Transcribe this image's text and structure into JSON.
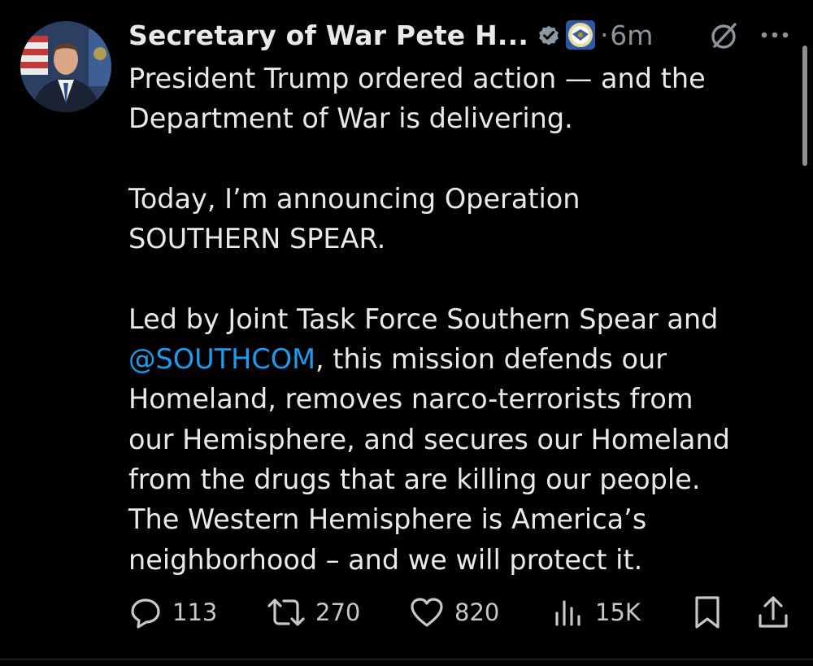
{
  "post": {
    "display_name": "Secretary of War Pete H...",
    "verified_icon": "verified-badge-icon",
    "affiliate_icon": "department-seal-icon",
    "separator": "·",
    "timestamp": "6m",
    "grok_icon": "grok-icon",
    "more_icon": "more-icon",
    "body": {
      "p1_l1": "President Trump ordered action — and the",
      "p1_l2": "Department of War is delivering.",
      "p2_l1": "Today, I’m announcing Operation",
      "p2_l2": "SOUTHERN SPEAR.",
      "p3_l1": "Led by Joint Task Force Southern Spear and",
      "p3_mention": "@SOUTHCOM",
      "p3_l2_rest": ", this mission defends our",
      "p3_l3": "Homeland, removes narco-terrorists from",
      "p3_l4": "our Hemisphere, and secures our Homeland",
      "p3_l5": "from the drugs that are killing our people.",
      "p3_l6": "The Western Hemisphere is America’s",
      "p3_l7": "neighborhood – and we will protect it."
    },
    "actions": {
      "replies": "113",
      "reposts": "270",
      "likes": "820",
      "views": "15K"
    },
    "colors": {
      "background": "#000000",
      "text": "#e7e9ea",
      "secondary": "#8b949a",
      "link": "#1d9bf0",
      "verified": "#8b98a5"
    }
  }
}
